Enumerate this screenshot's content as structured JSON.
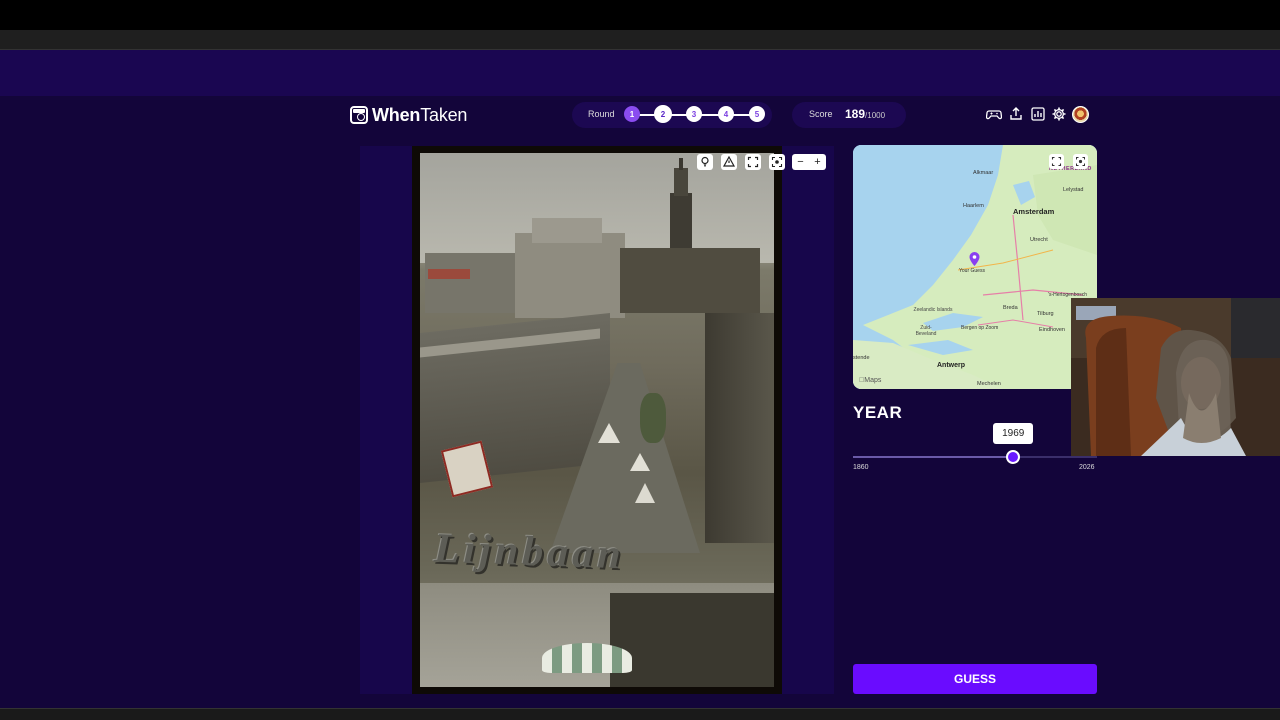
{
  "app": {
    "logo_bold": "When",
    "logo_thin": "Taken"
  },
  "round": {
    "label": "Round",
    "steps": [
      "1",
      "2",
      "3",
      "4",
      "5"
    ],
    "current": 1
  },
  "score": {
    "label": "Score",
    "value": "189",
    "max": "/1000"
  },
  "header_icons": [
    "gamepad-icon",
    "share-icon",
    "stats-icon",
    "settings-icon",
    "avatar"
  ],
  "photo": {
    "sign_text": "Lijnbaan",
    "tools": [
      "bulb-icon",
      "warning-icon",
      "fullscreen-icon",
      "focus-icon"
    ],
    "zoom_out": "−",
    "zoom_in": "+"
  },
  "map": {
    "labels": {
      "alkmaar": "Alkmaar",
      "amsterdam": "Amsterdam",
      "lelystad": "Lelystad",
      "haarlem": "Haarlem",
      "utrecht": "Utrecht",
      "your_guess": "Your Guess",
      "hertogenbosch": "'s-Hertogenbosch",
      "breda": "Breda",
      "tilburg": "Tilburg",
      "zeelandic": "Zeelandic Islands",
      "zuid_beveland": "Zuid-Beveland",
      "bergen": "Bergen op Zoom",
      "eindhoven": "Eindhoven",
      "ostende": "stende",
      "antwerp": "Antwerp",
      "mechelen": "Mechelen",
      "netherlands": "NETHERLAND",
      "apple_maps": "Maps"
    },
    "tools": [
      "expand-icon",
      "locate-icon"
    ]
  },
  "year": {
    "label": "YEAR",
    "min": "1860",
    "max": "2026",
    "value": "1969",
    "min_num": 1860,
    "max_num": 2026,
    "value_num": 1969
  },
  "guess_label": "GUESS",
  "colors": {
    "background": "#13053a",
    "accent": "#6a0cff",
    "round_active": "#8a4cf0"
  }
}
